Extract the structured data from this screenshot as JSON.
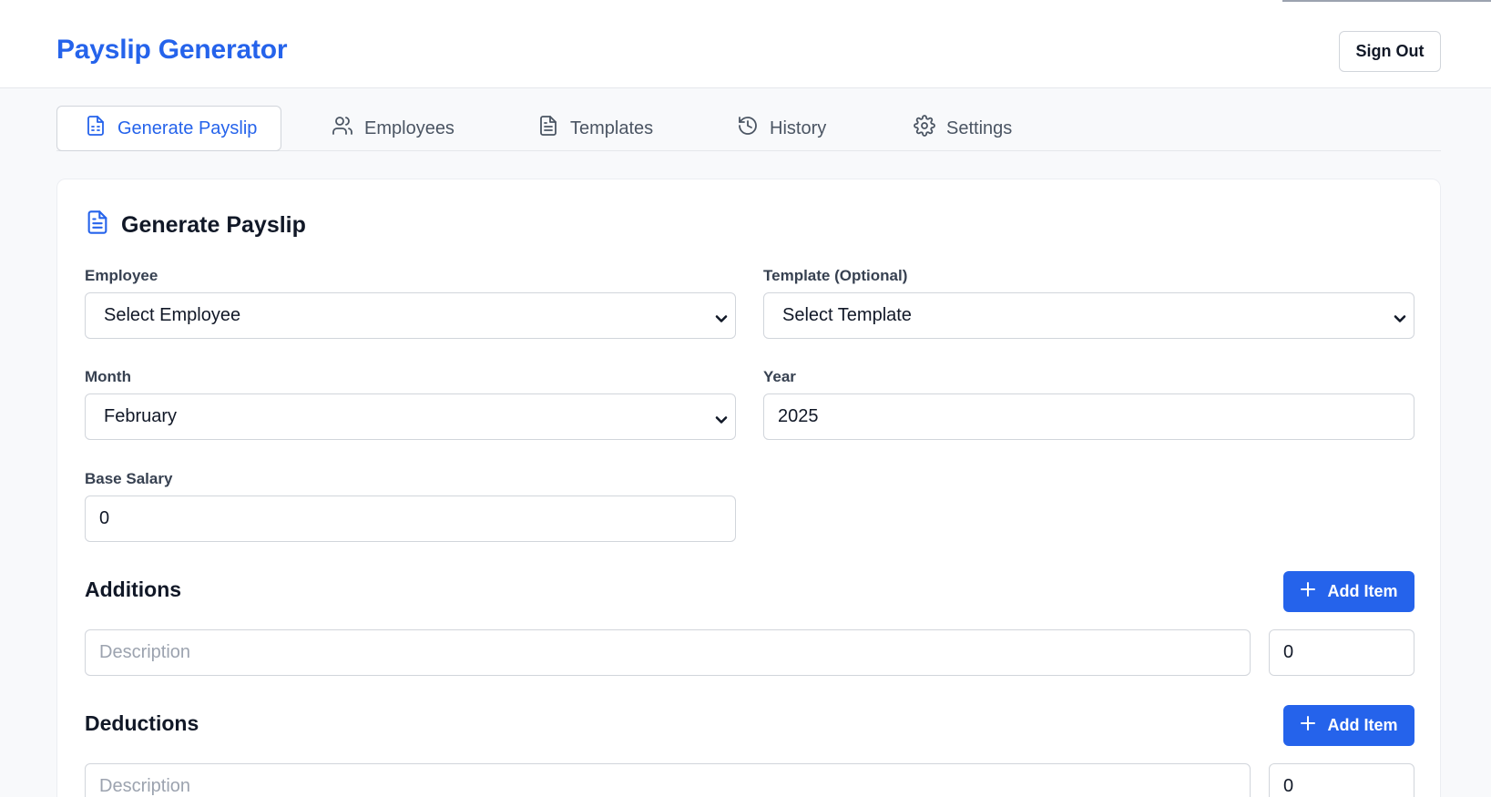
{
  "header": {
    "app_title": "Payslip Generator",
    "sign_out_label": "Sign Out"
  },
  "tabs": [
    {
      "label": "Generate Payslip",
      "icon": "file-spreadsheet-icon",
      "active": true
    },
    {
      "label": "Employees",
      "icon": "users-icon",
      "active": false
    },
    {
      "label": "Templates",
      "icon": "file-text-icon",
      "active": false
    },
    {
      "label": "History",
      "icon": "history-icon",
      "active": false
    },
    {
      "label": "Settings",
      "icon": "gear-icon",
      "active": false
    }
  ],
  "form": {
    "title": "Generate Payslip",
    "employee": {
      "label": "Employee",
      "value": "Select Employee"
    },
    "template": {
      "label": "Template (Optional)",
      "value": "Select Template"
    },
    "month": {
      "label": "Month",
      "value": "February"
    },
    "year": {
      "label": "Year",
      "value": "2025"
    },
    "base_salary": {
      "label": "Base Salary",
      "value": "0"
    },
    "additions": {
      "title": "Additions",
      "add_label": "Add Item",
      "item": {
        "description_placeholder": "Description",
        "amount": "0"
      }
    },
    "deductions": {
      "title": "Deductions",
      "add_label": "Add Item",
      "item": {
        "description_placeholder": "Description",
        "amount": "0"
      }
    }
  },
  "colors": {
    "accent": "#2563eb",
    "background": "#f8f9fb",
    "border": "#d1d5db"
  }
}
